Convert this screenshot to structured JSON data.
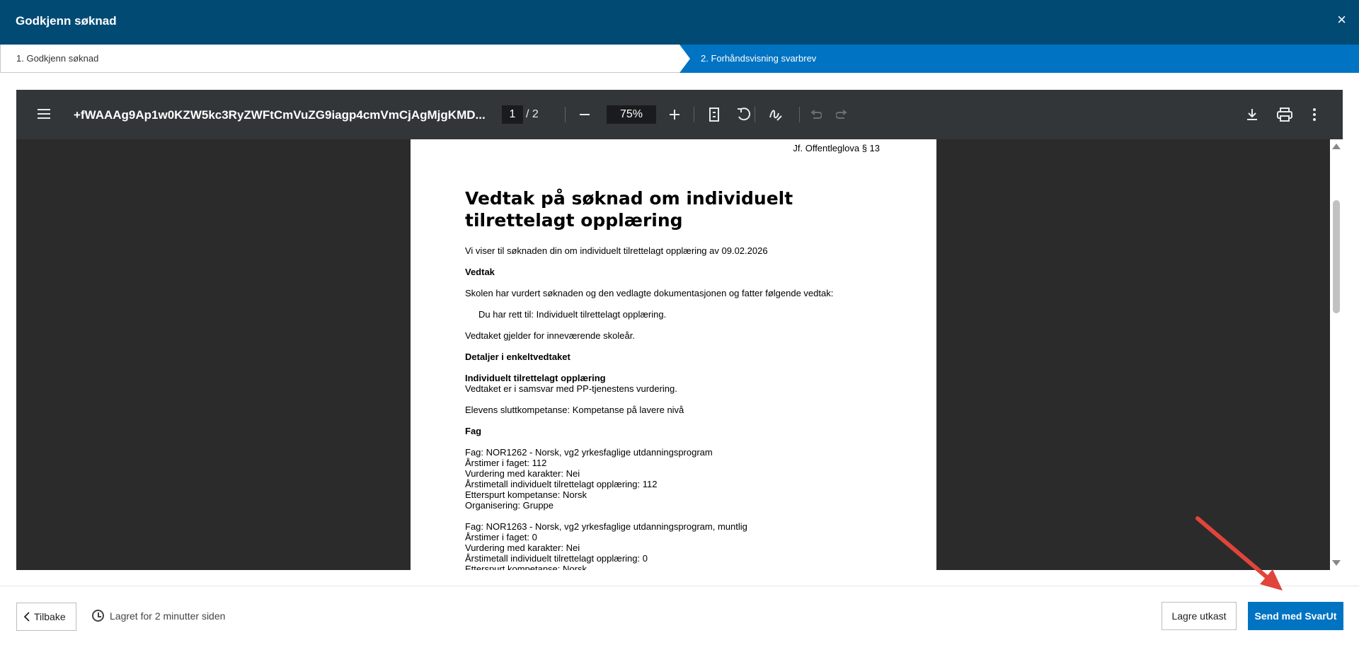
{
  "header": {
    "title": "Godkjenn søknad",
    "close_symbol": "×"
  },
  "steps": [
    {
      "label": "1. Godkjenn søknad"
    },
    {
      "label": "2. Forhåndsvisning svarbrev"
    }
  ],
  "viewer": {
    "filename": "+fWAAAg9Ap1w0KZW5kc3RyZWFtCmVuZG9iagp4cmVmCjAgMjgKMD...",
    "page_current": "1",
    "page_total": "/  2",
    "zoom": "75%"
  },
  "document": {
    "ref": "Jf. Offentleglova § 13",
    "title": "Vedtak på søknad om individuelt tilrettelagt opplæring",
    "lines": [
      {
        "text": "Vi viser til søknaden din om individuelt tilrettelagt opplæring av 09.02.2026",
        "bold": false
      },
      {
        "text": "Vedtak",
        "bold": true
      },
      {
        "text": "Skolen har vurdert søknaden og den vedlagte dokumentasjonen og fatter følgende vedtak:",
        "bold": false
      },
      {
        "text": "Du har rett til: Individuelt tilrettelagt opplæring.",
        "bold": false
      },
      {
        "text": "Vedtaket gjelder for inneværende skoleår.",
        "bold": false
      },
      {
        "text": "Detaljer i enkeltvedtaket",
        "bold": true
      },
      {
        "text": "Individuelt tilrettelagt opplæring",
        "bold": true
      },
      {
        "text": "Vedtaket er i samsvar med PP-tjenestens vurdering.",
        "bold": false
      },
      {
        "text": "Elevens sluttkompetanse: Kompetanse på lavere nivå",
        "bold": false
      },
      {
        "text": "Fag",
        "bold": true
      },
      {
        "text": "Fag: NOR1262 - Norsk, vg2 yrkesfaglige utdanningsprogram",
        "bold": false
      },
      {
        "text": "Årstimer i faget: 112",
        "bold": false
      },
      {
        "text": "Vurdering med karakter: Nei",
        "bold": false
      },
      {
        "text": "Årstimetall individuelt tilrettelagt opplæring: 112",
        "bold": false
      },
      {
        "text": "Etterspurt kompetanse: Norsk",
        "bold": false
      },
      {
        "text": "Organisering: Gruppe",
        "bold": false
      },
      {
        "text": "Fag: NOR1263 - Norsk, vg2 yrkesfaglige utdanningsprogram, muntlig",
        "bold": false
      },
      {
        "text": "Årstimer i faget: 0",
        "bold": false
      },
      {
        "text": "Vurdering med karakter: Nei",
        "bold": false
      },
      {
        "text": "Årstimetall individuelt tilrettelagt opplæring: 0",
        "bold": false
      },
      {
        "text": "Etterspurt kompetanse: Norsk",
        "bold": false
      }
    ]
  },
  "footer": {
    "back_label": "Tilbake",
    "saved_text": "Lagret for 2 minutter siden",
    "draft_label": "Lagre utkast",
    "send_label": "Send med SvarUt"
  },
  "colors": {
    "header_bg": "#004a74",
    "accent": "#0073c2",
    "annotation_arrow": "#e0443a"
  },
  "icons": [
    "close-icon",
    "menu-icon",
    "minus-icon",
    "plus-icon",
    "fit-page-icon",
    "rotate-icon",
    "annotate-icon",
    "undo-icon",
    "redo-icon",
    "download-icon",
    "print-icon",
    "more-icon",
    "chevron-left-icon",
    "clock-icon"
  ]
}
